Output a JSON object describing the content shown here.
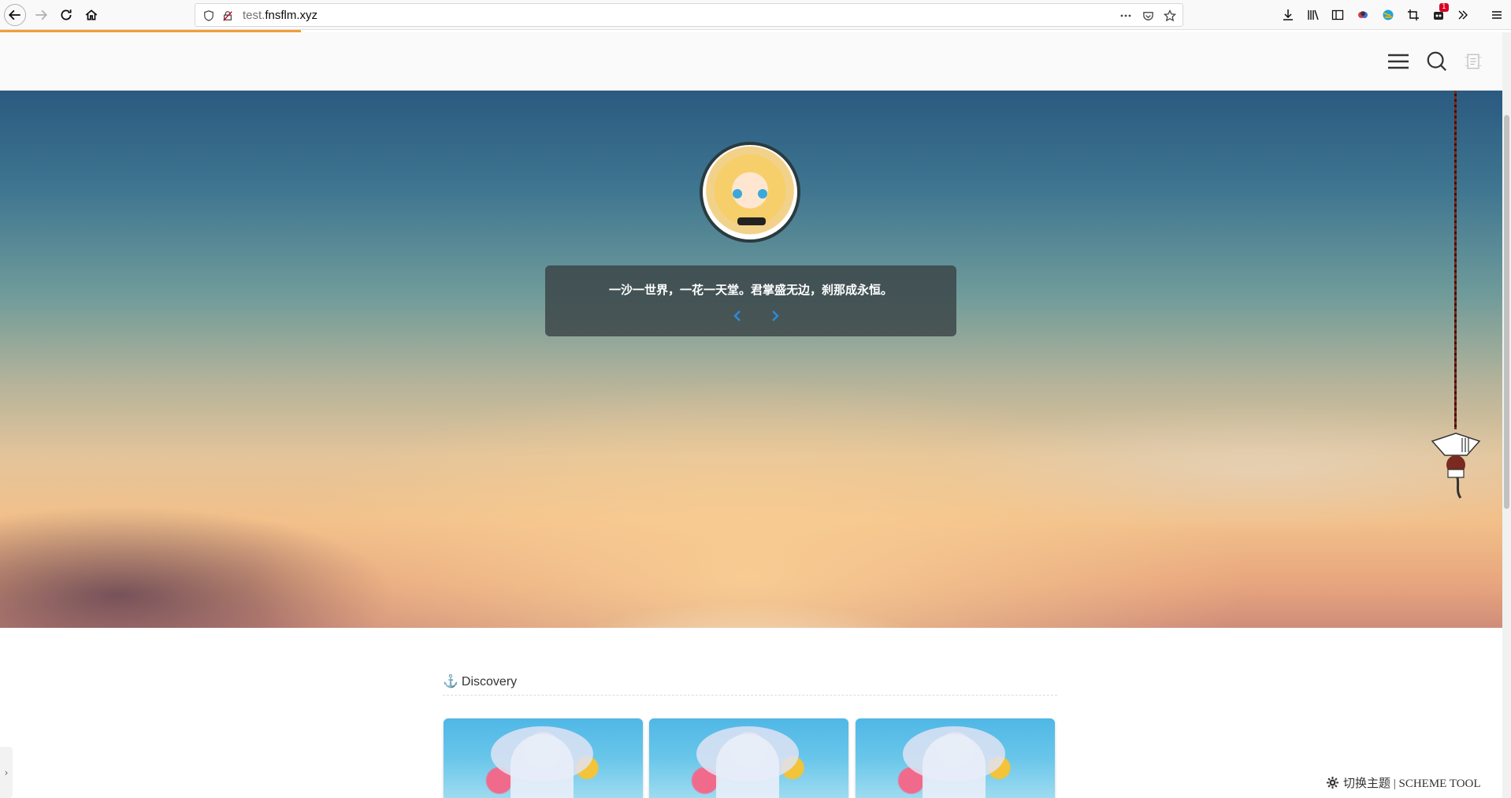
{
  "browser": {
    "url_host_dim": "test.",
    "url_host": "fnsflm.xyz",
    "notification_badge": "1"
  },
  "hero": {
    "quote": "一沙一世界，一花一天堂。君掌盛无边，刹那成永恒。"
  },
  "content": {
    "section_title": "Discovery"
  },
  "footer": {
    "scheme_tool": "切换主题 | SCHEME TOOL"
  },
  "colors": {
    "accent": "#2b8bd8",
    "progress": "#f29d38"
  }
}
